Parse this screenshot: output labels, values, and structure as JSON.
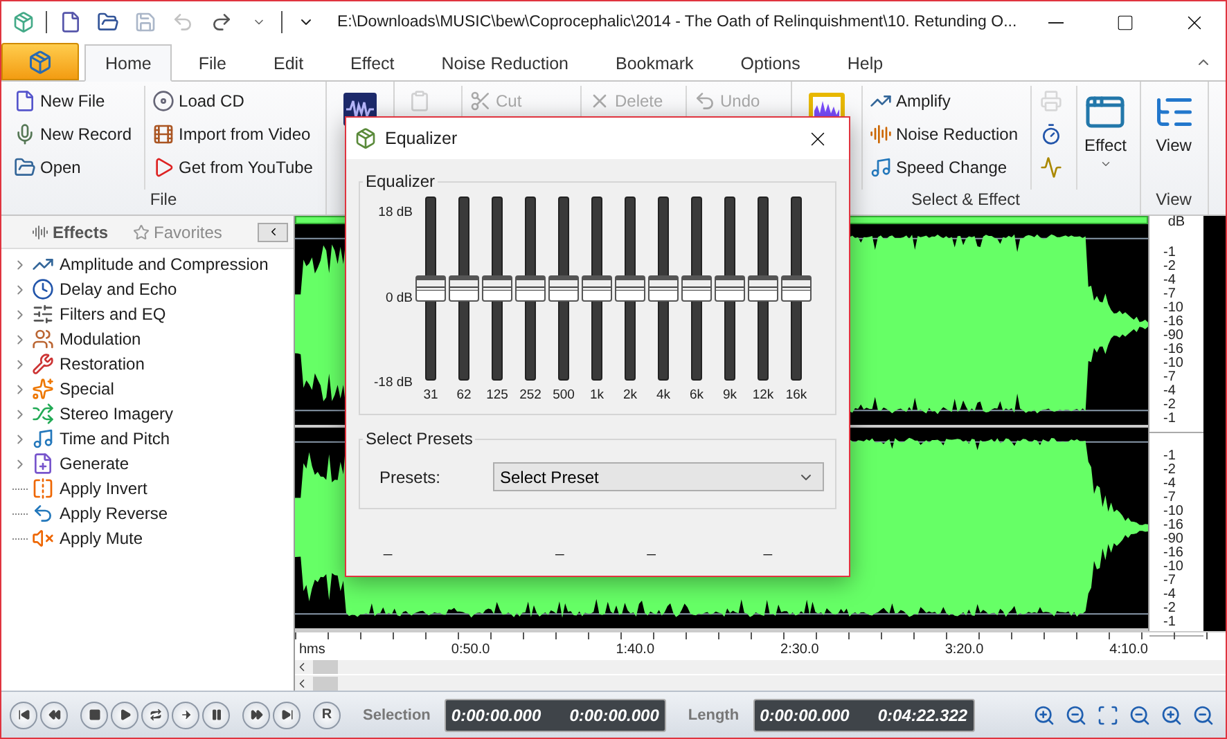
{
  "title_bar": {
    "title": "E:\\Downloads\\MUSIC\\bew\\Coprocephalic\\2014 - The Oath of Relinquishment\\10. Retunding O...",
    "quick_access": [
      {
        "disabled": false
      },
      {
        "disabled": false
      },
      {
        "disabled": false
      },
      {
        "disabled": true
      },
      {
        "disabled": true
      },
      {
        "disabled": false
      }
    ]
  },
  "ribbon_tabs": [
    {
      "label": "Home",
      "selected": true
    },
    {
      "label": "File",
      "selected": false
    },
    {
      "label": "Edit",
      "selected": false
    },
    {
      "label": "Effect",
      "selected": false
    },
    {
      "label": "Noise Reduction",
      "selected": false
    },
    {
      "label": "Bookmark",
      "selected": false
    },
    {
      "label": "Options",
      "selected": false
    },
    {
      "label": "Help",
      "selected": false
    }
  ],
  "ribbon_groups": [
    {
      "label": "File",
      "columns": [
        [
          {
            "kind": "small",
            "label": "New File",
            "disabled": false
          },
          {
            "kind": "small",
            "label": "New Record",
            "disabled": false
          },
          {
            "kind": "small",
            "label": "Open",
            "disabled": false
          }
        ],
        [
          {
            "kind": "small",
            "label": "Load CD",
            "disabled": false
          },
          {
            "kind": "small",
            "label": "Import from Video",
            "disabled": false
          },
          {
            "kind": "small",
            "label": "Get from YouTube",
            "disabled": false
          }
        ]
      ]
    },
    {
      "columns": [
        [
          {
            "kind": "large",
            "disabled": false
          }
        ]
      ]
    },
    {
      "columns": [
        [
          {
            "kind": "icon",
            "disabled": true
          }
        ],
        [
          {
            "kind": "small",
            "label": "Cut",
            "disabled": true
          }
        ],
        [
          {
            "kind": "small",
            "label": "Delete",
            "disabled": true
          }
        ],
        [
          {
            "kind": "small",
            "label": "Undo",
            "disabled": true
          }
        ]
      ]
    },
    {
      "label": "Select & Effect",
      "columns": [
        [
          {
            "kind": "large",
            "disabled": false
          }
        ],
        [
          {
            "kind": "small",
            "label": "Amplify",
            "disabled": false
          },
          {
            "kind": "small",
            "label": "Noise Reduction",
            "disabled": false
          },
          {
            "kind": "small",
            "label": "Speed Change",
            "disabled": false
          }
        ],
        [
          {
            "kind": "icon",
            "disabled": true
          },
          {
            "kind": "icon",
            "disabled": false
          },
          {
            "kind": "icon",
            "disabled": false
          }
        ],
        [
          {
            "kind": "large",
            "label": "Effect",
            "disabled": false
          }
        ]
      ]
    },
    {
      "label": "View",
      "columns": [
        [
          {
            "kind": "large",
            "label": "View",
            "disabled": false
          }
        ]
      ]
    }
  ],
  "panel_tabs": [
    {
      "label": "Effects",
      "selected": true
    },
    {
      "label": "Favorites",
      "selected": false
    }
  ],
  "effects": [
    {
      "kind": "category",
      "label": "Amplitude and Compression",
      "expanded": false
    },
    {
      "kind": "category",
      "label": "Delay and Echo",
      "expanded": false
    },
    {
      "kind": "category",
      "label": "Filters and EQ",
      "expanded": false
    },
    {
      "kind": "category",
      "label": "Modulation",
      "expanded": false
    },
    {
      "kind": "category",
      "label": "Restoration",
      "expanded": false
    },
    {
      "kind": "category",
      "label": "Special",
      "expanded": false
    },
    {
      "kind": "category",
      "label": "Stereo Imagery",
      "expanded": false
    },
    {
      "kind": "category",
      "label": "Time and Pitch",
      "expanded": false
    },
    {
      "kind": "category",
      "label": "Generate",
      "expanded": false
    },
    {
      "kind": "action",
      "label": "Apply Invert"
    },
    {
      "kind": "action",
      "label": "Apply Reverse"
    },
    {
      "kind": "action",
      "label": "Apply Mute"
    }
  ],
  "waveform": {
    "unit": "dB",
    "channels": [
      {
        "scale": [
          "-1",
          "-2",
          "-4",
          "-7",
          "-10",
          "-16",
          "-90",
          "-16",
          "-10",
          "-7",
          "-4",
          "-2",
          "-1"
        ]
      },
      {
        "scale": [
          "-1",
          "-2",
          "-4",
          "-7",
          "-10",
          "-16",
          "-90",
          "-16",
          "-10",
          "-7",
          "-4",
          "-2",
          "-1"
        ]
      }
    ],
    "ruler": [
      "hms",
      "0:50.0",
      "1:40.0",
      "2:30.0",
      "3:20.0",
      "4:10.0"
    ]
  },
  "equalizer": {
    "title": "Equalizer",
    "group_label": "Equalizer",
    "scale": [
      "18 dB",
      "0 dB",
      "-18 dB"
    ],
    "bands": [
      {
        "label": "31",
        "level": 0.5
      },
      {
        "label": "62",
        "level": 0.5
      },
      {
        "label": "125",
        "level": 0.5
      },
      {
        "label": "252",
        "level": 0.5
      },
      {
        "label": "500",
        "level": 0.5
      },
      {
        "label": "1k",
        "level": 0.5
      },
      {
        "label": "2k",
        "level": 0.5
      },
      {
        "label": "4k",
        "level": 0.5
      },
      {
        "label": "6k",
        "level": 0.5
      },
      {
        "label": "9k",
        "level": 0.5
      },
      {
        "label": "12k",
        "level": 0.5
      },
      {
        "label": "16k",
        "level": 0.5
      }
    ],
    "presets_group": "Select Presets",
    "presets_label": "Presets:",
    "preset_value": "Select Preset",
    "marks": [
      "_",
      "_",
      "_",
      "_"
    ]
  },
  "transport": {
    "buttons": [
      {
        "kind": "first"
      },
      {
        "kind": "rewind"
      },
      {
        "kind": "stop"
      },
      {
        "kind": "play"
      },
      {
        "kind": "loop"
      },
      {
        "kind": "next"
      },
      {
        "kind": "pause"
      },
      {
        "kind": "forward"
      },
      {
        "kind": "last"
      }
    ],
    "record_label": "R"
  },
  "selection": {
    "label": "Selection",
    "start": "0:00:00.000",
    "end": "0:00:00.000"
  },
  "length": {
    "label": "Length",
    "start": "0:00:00.000",
    "end": "0:04:22.322"
  }
}
